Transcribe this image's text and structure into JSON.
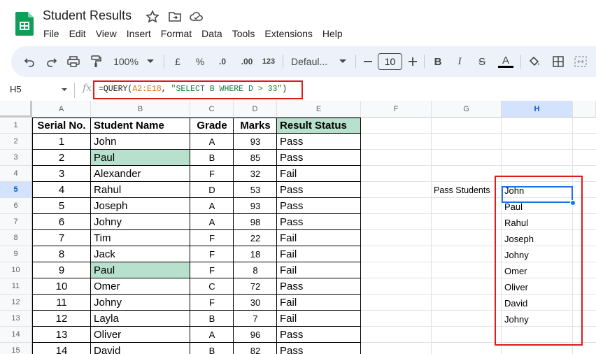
{
  "app": {
    "title": "Student Results",
    "menu": [
      "File",
      "Edit",
      "View",
      "Insert",
      "Format",
      "Data",
      "Tools",
      "Extensions",
      "Help"
    ],
    "brand_color": "#0f9d58"
  },
  "toolbar": {
    "zoom": "100%",
    "currency": "£",
    "percent": "%",
    "dec_decrease": ".0",
    "dec_increase": ".00",
    "number_format": "123",
    "font": "Defaul...",
    "font_size": "10",
    "bold": "B",
    "italic": "I",
    "strike": "S",
    "text_color": "A"
  },
  "formula_bar": {
    "name_box": "H5",
    "fx": "fx",
    "formula_prefix": "=QUERY(",
    "formula_range": "A2:E18",
    "formula_sep": ", ",
    "formula_string": "\"SELECT B  WHERE D > 33\"",
    "formula_suffix": ")"
  },
  "columns": [
    "A",
    "B",
    "C",
    "D",
    "E",
    "F",
    "G",
    "H"
  ],
  "selected_column": "H",
  "selected_row": "5",
  "rows": [
    "1",
    "2",
    "3",
    "4",
    "5",
    "6",
    "7",
    "8",
    "9",
    "10",
    "11",
    "12",
    "13",
    "14",
    "15"
  ],
  "table": {
    "headers": [
      "Serial No.",
      "Student  Name",
      "Grade",
      "Marks",
      "Result Status"
    ],
    "records": [
      [
        "1",
        "John",
        "A",
        "93",
        "Pass"
      ],
      [
        "2",
        "Paul",
        "B",
        "85",
        "Pass"
      ],
      [
        "3",
        "Alexander",
        "F",
        "32",
        "Fail"
      ],
      [
        "4",
        "Rahul",
        "D",
        "53",
        "Pass"
      ],
      [
        "5",
        "Joseph",
        "A",
        "93",
        "Pass"
      ],
      [
        "6",
        "Johny",
        "A",
        "98",
        "Pass"
      ],
      [
        "7",
        "Tim",
        "F",
        "22",
        "Fail"
      ],
      [
        "8",
        "Jack",
        "F",
        "18",
        "Fail"
      ],
      [
        "9",
        "Paul",
        "F",
        "8",
        "Fail"
      ],
      [
        "10",
        "Omer",
        "C",
        "72",
        "Pass"
      ],
      [
        "11",
        "Johny",
        "F",
        "30",
        "Fail"
      ],
      [
        "12",
        "Layla",
        "B",
        "7",
        "Fail"
      ],
      [
        "13",
        "Oliver",
        "A",
        "96",
        "Pass"
      ],
      [
        "14",
        "David",
        "B",
        "82",
        "Pass"
      ]
    ],
    "highlighted_name_rows": [
      1,
      8
    ],
    "highlight_color": "#b7e1cd"
  },
  "results": {
    "label": "Pass Students",
    "names": [
      "John",
      "Paul",
      "Rahul",
      "Joseph",
      "Johny",
      "Omer",
      "Oliver",
      "David",
      "Johny"
    ]
  }
}
